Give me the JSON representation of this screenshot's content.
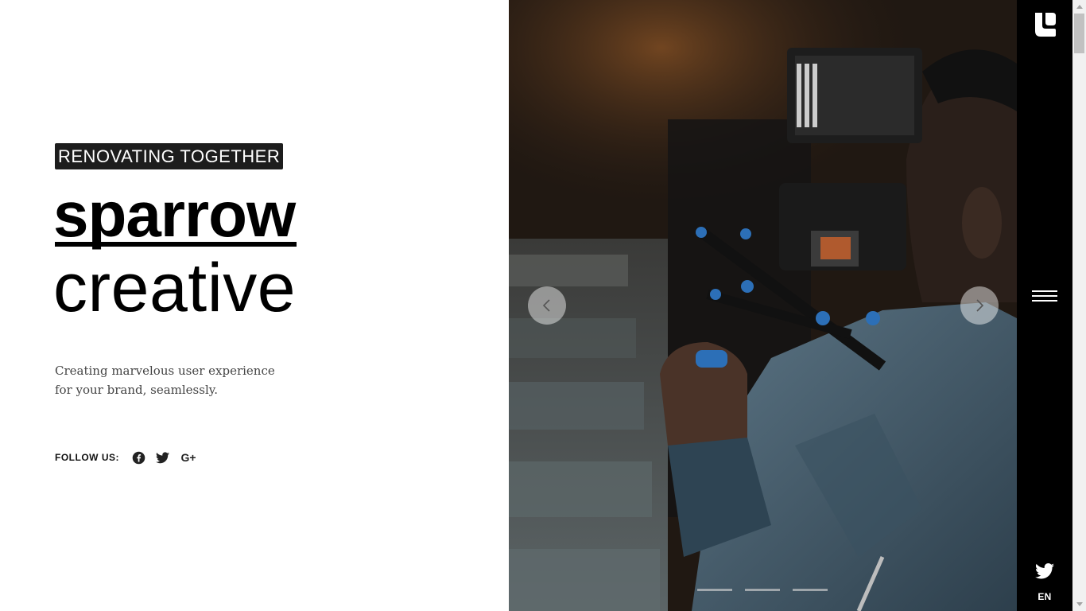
{
  "hero": {
    "tagline": "RENOVATING TOGETHER",
    "brand_bold": "sparrow",
    "brand_light": "creative",
    "description_line1": "Creating marvelous user experience",
    "description_line2": "for your brand, seamlessly.",
    "follow_label": "FOLLOW US:",
    "social": [
      "facebook-icon",
      "twitter-icon",
      "google-plus-icon"
    ],
    "google_plus_text": "G+"
  },
  "slider": {
    "slides": 3,
    "active_slide": 1,
    "image_subject": "person filming with camera rig"
  },
  "sidebar": {
    "language": "EN",
    "icons": [
      "sparrow-logo-icon",
      "hamburger-menu-icon",
      "twitter-icon"
    ]
  },
  "colors": {
    "sidebar_bg": "#000000",
    "tag_bg": "#1d1d1d",
    "text": "#111111",
    "description": "#444444"
  }
}
